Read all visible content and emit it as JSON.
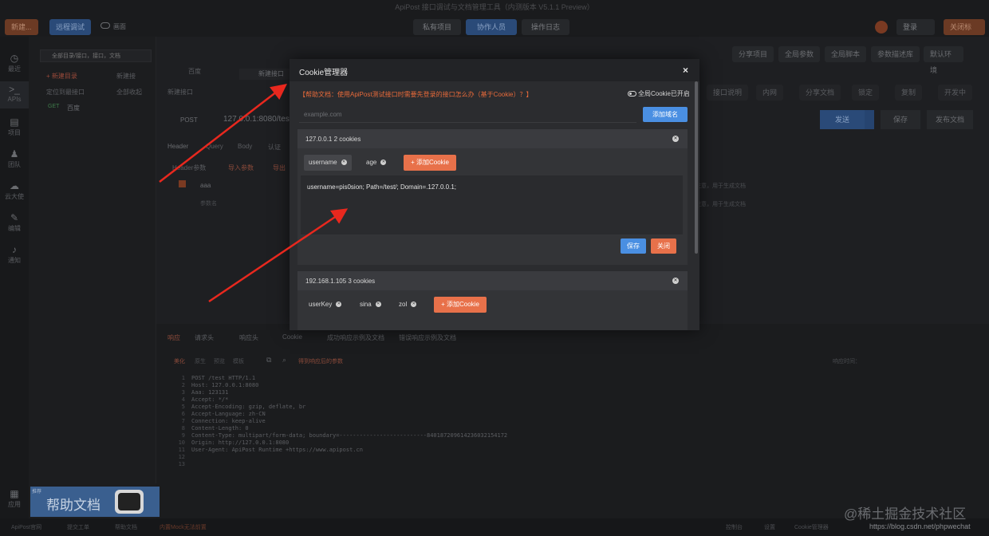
{
  "app": {
    "window_title": "ApiPost 接口调试与文档管理工具（内测版本 V5.1.1 Preview）",
    "new_button": "新建...",
    "remote_debug": "远程调试",
    "mode": "画面",
    "private_project": "私有项目",
    "invite": "协作人员",
    "log": "操作日志",
    "login": "登录",
    "window_controls": "关闭标"
  },
  "sidebar": {
    "items": [
      {
        "icon": "clock-icon",
        "label": "最近"
      },
      {
        "icon": "api-icon",
        "label": "APIs"
      },
      {
        "icon": "project-icon",
        "label": "项目"
      },
      {
        "icon": "team-icon",
        "label": "团队"
      },
      {
        "icon": "cloud-icon",
        "label": "云大使"
      },
      {
        "icon": "edit-icon",
        "label": "编辑"
      },
      {
        "icon": "bell-icon",
        "label": "通知"
      },
      {
        "icon": "apps-icon",
        "label": "应用"
      }
    ]
  },
  "tree": {
    "search_placeholder": "全部目录/接口，接口，文档",
    "new_folder": "+ 新建目录",
    "new_api": "新建接",
    "locate": "定位到最接口",
    "collapse": "全部收起",
    "item_method": "GET",
    "item_name": "百度"
  },
  "main": {
    "tab1": "百度",
    "tab2": "新建接口",
    "breadcrumb": "新建接口",
    "method": "POST",
    "url": "127.0.0.1:8080/test",
    "subtabs": [
      "Header",
      "Query",
      "Body",
      "认证"
    ],
    "header_section": "Header参数",
    "import": "导入参数",
    "export": "导出",
    "row_key": "aaa",
    "row_placeholder": "参数名",
    "send": "发送",
    "save": "保存",
    "publish": "发布文档",
    "share_project": "分享项目",
    "global_params": "全局参数",
    "global_script": "全局脚本",
    "params_desc": "参数描述库",
    "env": "默认环境",
    "api_desc": "接口说明",
    "mock": "内网",
    "share_doc": "分享文档",
    "lock": "锁定",
    "copy": "复制",
    "dev_status": "开发中",
    "hint1": "注意，用于生成文档",
    "hint2": "注意，用于生成文档"
  },
  "bottom": {
    "tabs": [
      "响应",
      "请求头",
      "响应头",
      "Cookie",
      "成功响应示例及文档",
      "错误响应示例及文档"
    ],
    "format_buttons": [
      "美化",
      "原生",
      "预览",
      "模板"
    ],
    "search_hint": "得到响应后的参数",
    "status_label": "响应时间：",
    "code": [
      "POST /test HTTP/1.1",
      "Host: 127.0.0.1:8080",
      "Aaa: 123131",
      "Accept: */*",
      "Accept-Encoding: gzip, deflate, br",
      "Accept-Language: zh-CN",
      "Connection: keep-alive",
      "Content-Length: 0",
      "Content-Type: multipart/form-data; boundary=--------------------------840187209614236032154172",
      "Origin: http://127.0.0.1:8080",
      "User-Agent: ApiPost Runtime +https://www.apipost.cn",
      "",
      ""
    ]
  },
  "modal": {
    "title": "Cookie管理器",
    "close": "×",
    "help_text": "【帮助文档：使用ApiPost测试接口时需要先登录的接口怎么办（基于Cookie）？】",
    "global_toggle": "全局Cookie已开启",
    "domain_placeholder": "example.com",
    "add_domain": "添加域名",
    "domains": [
      {
        "title": "127.0.0.1  2 cookies",
        "cookies": [
          "username",
          "age"
        ],
        "add_cookie": "+ 添加Cookie",
        "editor_value": "username=pis0sion; Path=/test/; Domain=.127.0.0.1;",
        "save": "保存",
        "close": "关闭"
      },
      {
        "title": "192.168.1.105  3 cookies",
        "cookies": [
          "userKey",
          "sina",
          "zol"
        ],
        "add_cookie": "+ 添加Cookie"
      }
    ]
  },
  "footer": {
    "left": [
      "ApiPost官网",
      "提交工单",
      "帮助文档",
      "内置Mock无法前置"
    ],
    "right": [
      "控制台",
      "设置",
      "Cookie管理器"
    ]
  },
  "banner": {
    "tag": "推荐",
    "text": "帮助文档"
  },
  "watermark": {
    "line1": "@稀土掘金技术社区",
    "line2": "https://blog.csdn.net/phpwechat"
  },
  "colors": {
    "accent_blue": "#4a8fe2",
    "accent_orange": "#e8714a",
    "help_orange": "#e86a3a",
    "arrow_red": "#e8281e"
  }
}
